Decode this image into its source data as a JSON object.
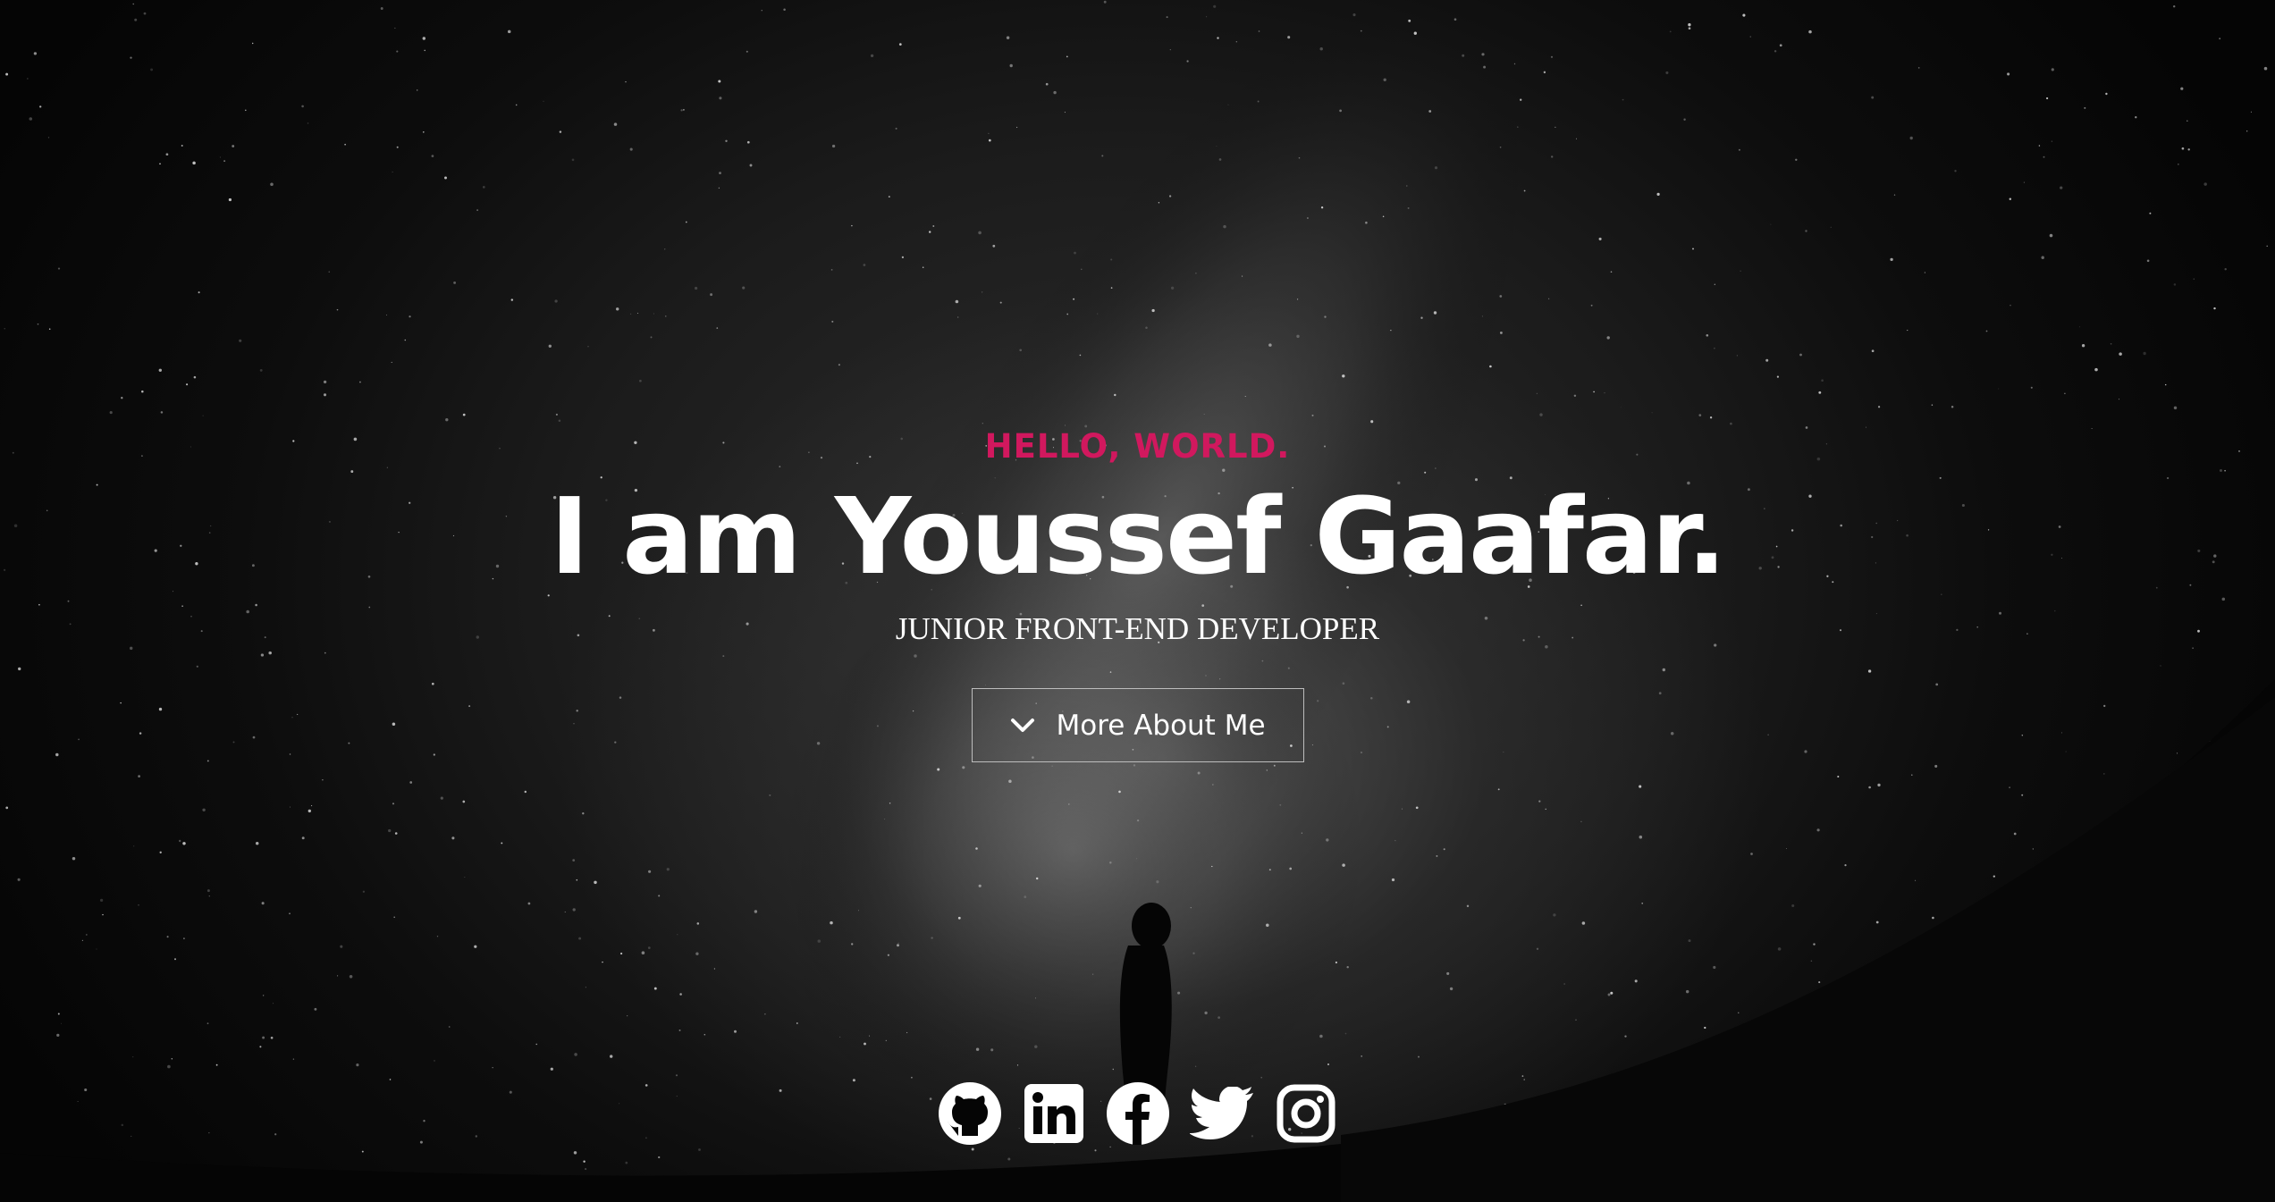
{
  "hero": {
    "greeting": "HELLO, WORLD.",
    "name": "I am Youssef Gaafar.",
    "role": "JUNIOR FRONT-END DEVELOPER",
    "button_label": "More About Me",
    "button_icon": "chevron-down-icon"
  },
  "socials": [
    {
      "name": "github",
      "icon": "github-icon"
    },
    {
      "name": "linkedin",
      "icon": "linkedin-icon"
    },
    {
      "name": "facebook",
      "icon": "facebook-icon"
    },
    {
      "name": "twitter",
      "icon": "twitter-icon"
    },
    {
      "name": "instagram",
      "icon": "instagram-icon"
    }
  ],
  "colors": {
    "accent": "#d1185e",
    "text": "#ffffff",
    "background": "#050505"
  }
}
